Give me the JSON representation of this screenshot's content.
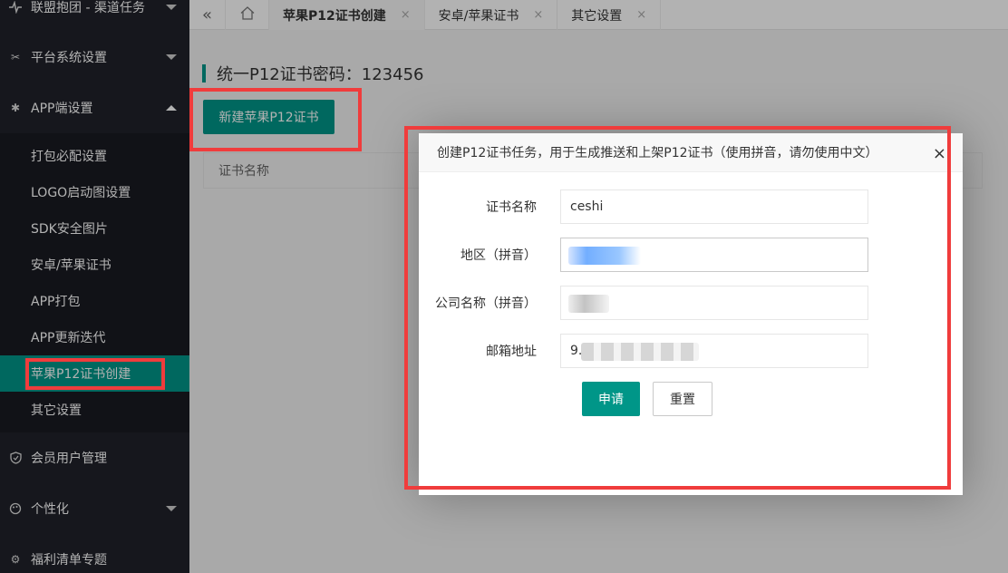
{
  "sidebar": {
    "top_items": [
      {
        "label": "联盟抱团 - 渠道任务",
        "icon": "pulse-icon"
      },
      {
        "label": "平台系统设置",
        "icon": "tools-icon"
      },
      {
        "label": "APP端设置",
        "icon": "gear-icon"
      },
      {
        "label": "会员用户管理",
        "icon": "shield-icon"
      },
      {
        "label": "个性化",
        "icon": "palette-icon"
      },
      {
        "label": "福利清单专题",
        "icon": "settings-icon"
      }
    ],
    "sub_items": [
      {
        "label": "打包必配设置"
      },
      {
        "label": "LOGO启动图设置"
      },
      {
        "label": "SDK安全图片"
      },
      {
        "label": "安卓/苹果证书"
      },
      {
        "label": "APP打包"
      },
      {
        "label": "APP更新迭代"
      },
      {
        "label": "苹果P12证书创建"
      },
      {
        "label": "其它设置"
      }
    ]
  },
  "tabs": {
    "back_icon": "«",
    "home_icon": "home-icon",
    "items": [
      {
        "label": "苹果P12证书创建",
        "close": "×"
      },
      {
        "label": "安卓/苹果证书",
        "close": "×"
      },
      {
        "label": "其它设置",
        "close": "×"
      }
    ]
  },
  "main": {
    "title": "统一P12证书密码：123456",
    "new_button": "新建苹果P12证书",
    "table_header": "证书名称"
  },
  "modal": {
    "title": "创建P12证书任务，用于生成推送和上架P12证书（使用拼音，请勿使用中文）",
    "close": "×",
    "fields": [
      {
        "label": "证书名称",
        "value": "ceshi"
      },
      {
        "label": "地区（拼音）",
        "value": ""
      },
      {
        "label": "公司名称（拼音）",
        "value": ""
      },
      {
        "label": "邮箱地址",
        "value": "9."
      }
    ],
    "submit": "申请",
    "reset": "重置"
  },
  "colors": {
    "accent": "#009688",
    "sidebar_bg": "#20222a",
    "submenu_bg": "#191a21",
    "highlight": "#f03c3c"
  }
}
